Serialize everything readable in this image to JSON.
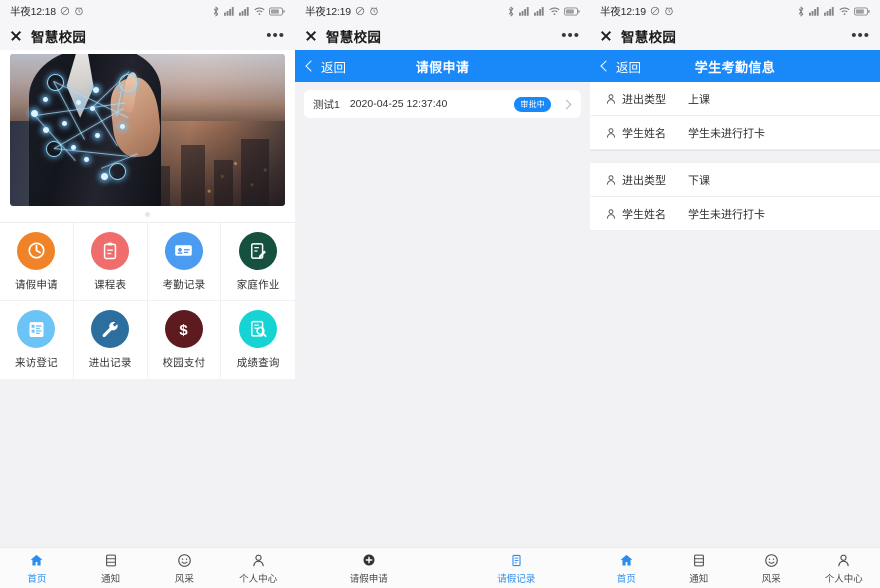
{
  "theme": {
    "accent": "#1989fa",
    "page_bg": "#f2f2f4",
    "card_bg": "#ffffff",
    "tab_active": "#2b8cf0"
  },
  "screens": [
    {
      "id": "home",
      "status_bar": {
        "time": "半夜12:18",
        "icons": [
          "mute-icon",
          "alarm-icon",
          "bluetooth-icon",
          "signal-icon",
          "signal-icon",
          "wifi-icon",
          "battery-icon"
        ]
      },
      "appbar": {
        "title": "智慧校园",
        "close_icon": "close-icon",
        "more_icon": "more-dots-icon"
      },
      "banner": {
        "alt": "businessman touching glowing network nodes over city skyline at dusk",
        "dots": 1,
        "active_dot": 0
      },
      "grid": [
        {
          "label": "请假申请",
          "icon": "clock-icon",
          "color": "#f08328"
        },
        {
          "label": "课程表",
          "icon": "clipboard-icon",
          "color": "#ef6d6d"
        },
        {
          "label": "考勤记录",
          "icon": "id-card-icon",
          "color": "#4b9bf0"
        },
        {
          "label": "家庭作业",
          "icon": "pencil-note-icon",
          "color": "#16513f"
        },
        {
          "label": "来访登记",
          "icon": "list-box-icon",
          "color": "#6cc3f5"
        },
        {
          "label": "进出记录",
          "icon": "wrench-icon",
          "color": "#2c6e9e"
        },
        {
          "label": "校园支付",
          "icon": "dollar-icon",
          "color": "#5d1b1f"
        },
        {
          "label": "成绩查询",
          "icon": "search-doc-icon",
          "color": "#17d4d4"
        }
      ],
      "tabbar": [
        {
          "label": "首页",
          "icon": "home-icon",
          "active": true
        },
        {
          "label": "通知",
          "icon": "bell-doc-icon",
          "active": false
        },
        {
          "label": "风采",
          "icon": "smiley-icon",
          "active": false
        },
        {
          "label": "个人中心",
          "icon": "person-icon",
          "active": false
        }
      ]
    },
    {
      "id": "leave-records",
      "status_bar": {
        "time": "半夜12:19"
      },
      "appbar": {
        "title": "智慧校园",
        "close_icon": "close-icon",
        "more_icon": "more-dots-icon"
      },
      "header": {
        "back_label": "返回",
        "back_icon": "chevron-left-icon",
        "title": "请假申请"
      },
      "records": [
        {
          "name": "测试1",
          "date": "2020-04-25 12:37:40",
          "status": "审批中",
          "chevron": "chevron-right-icon"
        }
      ],
      "tabbar": [
        {
          "label": "请假申请",
          "icon": "plus-circle-icon",
          "active": false
        },
        {
          "label": "请假记录",
          "icon": "record-doc-icon",
          "active": true
        }
      ]
    },
    {
      "id": "attendance",
      "status_bar": {
        "time": "半夜12:19"
      },
      "appbar": {
        "title": "智慧校园",
        "close_icon": "close-icon",
        "more_icon": "more-dots-icon"
      },
      "header": {
        "back_label": "返回",
        "back_icon": "chevron-left-icon",
        "title": "学生考勤信息"
      },
      "groups": [
        {
          "rows": [
            {
              "icon": "person-icon",
              "label": "进出类型",
              "value": "上课"
            },
            {
              "icon": "person-icon",
              "label": "学生姓名",
              "value": "学生未进行打卡"
            }
          ]
        },
        {
          "rows": [
            {
              "icon": "person-icon",
              "label": "进出类型",
              "value": "下课"
            },
            {
              "icon": "person-icon",
              "label": "学生姓名",
              "value": "学生未进行打卡"
            }
          ]
        }
      ],
      "tabbar": [
        {
          "label": "首页",
          "icon": "home-icon",
          "active": true
        },
        {
          "label": "通知",
          "icon": "bell-doc-icon",
          "active": false
        },
        {
          "label": "风采",
          "icon": "smiley-icon",
          "active": false
        },
        {
          "label": "个人中心",
          "icon": "person-icon",
          "active": false
        }
      ]
    }
  ]
}
